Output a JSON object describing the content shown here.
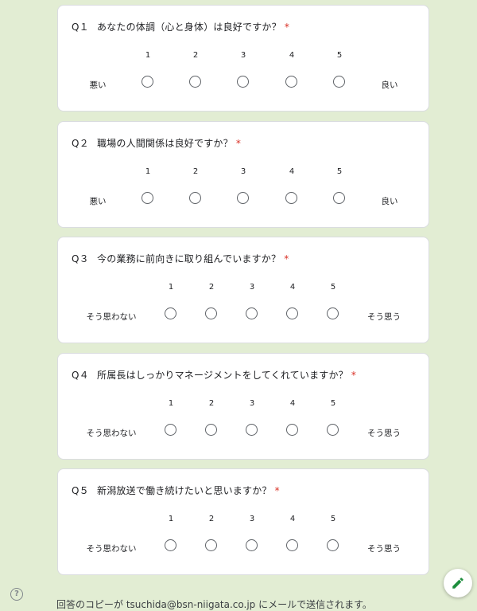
{
  "questions": [
    {
      "num": "Q１",
      "text": "あなたの体調（心と身体）は良好ですか？",
      "required_mark": "*",
      "scale": [
        "1",
        "2",
        "3",
        "4",
        "5"
      ],
      "low_label": "悪い",
      "high_label": "良い"
    },
    {
      "num": "Q２",
      "text": "職場の人間関係は良好ですか？",
      "required_mark": "*",
      "scale": [
        "1",
        "2",
        "3",
        "4",
        "5"
      ],
      "low_label": "悪い",
      "high_label": "良い"
    },
    {
      "num": "Q３",
      "text": "今の業務に前向きに取り組んでいますか？",
      "required_mark": "*",
      "scale": [
        "1",
        "2",
        "3",
        "4",
        "5"
      ],
      "low_label": "そう思わない",
      "high_label": "そう思う"
    },
    {
      "num": "Q４",
      "text": "所属長はしっかりマネージメントをしてくれていますか？",
      "required_mark": "*",
      "scale": [
        "1",
        "2",
        "3",
        "4",
        "5"
      ],
      "low_label": "そう思わない",
      "high_label": "そう思う"
    },
    {
      "num": "Q５",
      "text": "新潟放送で働き続けたいと思いますか？",
      "required_mark": "*",
      "scale": [
        "1",
        "2",
        "3",
        "4",
        "5"
      ],
      "low_label": "そう思わない",
      "high_label": "そう思う"
    }
  ],
  "footer": {
    "copy_notice": "回答のコピーが tsuchida@bsn-niigata.co.jp にメールで送信されます。"
  },
  "icons": {
    "help": "help-circle-icon",
    "edit": "pencil-icon"
  },
  "colors": {
    "background": "#e2edd3",
    "required": "#d93025",
    "fab_icon": "#1e8e3e"
  }
}
